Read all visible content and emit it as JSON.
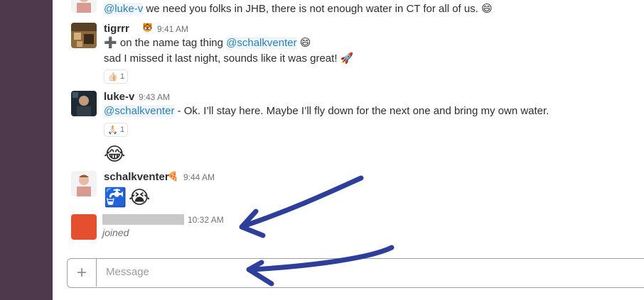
{
  "messages": [
    {
      "id": "m1",
      "text_mention": "@luke-v",
      "text_rest": " we need you folks in JHB, there is not enough water in CT for all of us.",
      "emoji": "😄"
    },
    {
      "id": "m2",
      "username": "tigrrr",
      "status_emoji": "🐯",
      "timestamp": "9:41 AM",
      "line1_prefix_emoji": "➕",
      "line1_text": " on the name tag thing ",
      "line1_mention": "@schalkventer",
      "line1_emoji": "😄",
      "line2_text": "sad I missed it last night, sounds like it was great!",
      "line2_emoji": "🚀",
      "reaction": {
        "emoji": "👍🏻",
        "count": "1"
      }
    },
    {
      "id": "m3",
      "username": "luke-v",
      "timestamp": "9:43 AM",
      "mention": "@schalkventer",
      "text": " - Ok. I’ll stay here. Maybe I’ll fly down for the next one and bring my own water.",
      "reaction": {
        "emoji": "🙏🏻",
        "count": "1"
      },
      "followup_emoji": "😂"
    },
    {
      "id": "m4",
      "username": "schalkventer",
      "status_emoji": "🍕",
      "timestamp": "9:44 AM",
      "emojis": [
        "🚰",
        "😭"
      ]
    },
    {
      "id": "m5",
      "timestamp": "10:32 AM",
      "text": "joined"
    }
  ],
  "composer": {
    "plus_label": "+",
    "placeholder": "Message"
  },
  "colors": {
    "sidebar": "#4d394b",
    "mention": "#2a80b9",
    "annotation_arrow": "#2d3f9a",
    "joined_avatar": "#e4502f"
  }
}
